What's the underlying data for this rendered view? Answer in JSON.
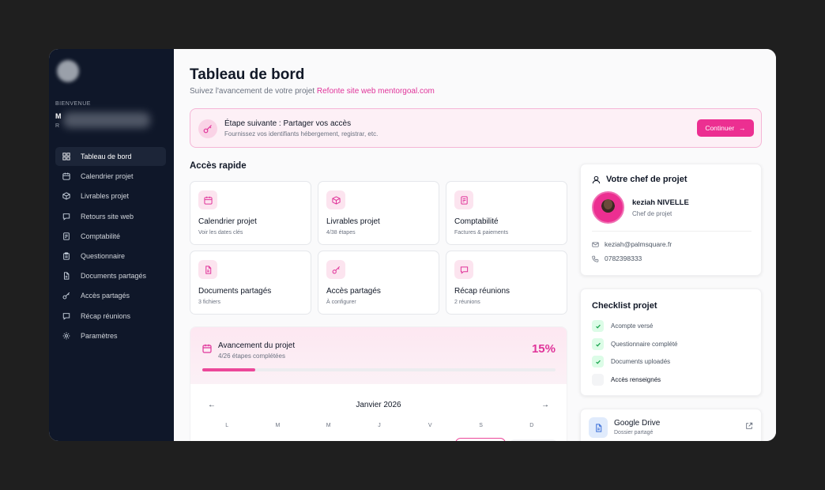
{
  "sidebar": {
    "welcome": "BIENVENUE",
    "user_initial": "M",
    "user_sub_initial": "R",
    "items": [
      {
        "label": "Tableau de bord",
        "icon": "dashboard-icon",
        "active": true
      },
      {
        "label": "Calendrier projet",
        "icon": "calendar-icon"
      },
      {
        "label": "Livrables projet",
        "icon": "package-icon"
      },
      {
        "label": "Retours site web",
        "icon": "message-icon"
      },
      {
        "label": "Comptabilité",
        "icon": "receipt-icon"
      },
      {
        "label": "Questionnaire",
        "icon": "clipboard-icon"
      },
      {
        "label": "Documents partagés",
        "icon": "document-icon"
      },
      {
        "label": "Accès partagés",
        "icon": "key-icon"
      },
      {
        "label": "Récap réunions",
        "icon": "chat-icon"
      },
      {
        "label": "Paramètres",
        "icon": "gear-icon"
      }
    ]
  },
  "header": {
    "title": "Tableau de bord",
    "subtitle_prefix": "Suivez l'avancement de votre projet",
    "project_link": "Refonte site web mentorgoal.com"
  },
  "banner": {
    "title": "Étape suivante : Partager vos accès",
    "description": "Fournissez vos identifiants hébergement, registrar, etc.",
    "button_label": "Continuer",
    "button_arrow": "→"
  },
  "quick_access": {
    "title": "Accès rapide",
    "cards": [
      {
        "title": "Calendrier projet",
        "sub": "Voir les dates clés",
        "icon": "calendar-icon"
      },
      {
        "title": "Livrables projet",
        "sub": "4/38 étapes",
        "icon": "package-icon"
      },
      {
        "title": "Comptabilité",
        "sub": "Factures & paiements",
        "icon": "receipt-icon"
      },
      {
        "title": "Documents partagés",
        "sub": "3 fichiers",
        "icon": "document-icon"
      },
      {
        "title": "Accès partagés",
        "sub": "À configurer",
        "icon": "key-icon"
      },
      {
        "title": "Récap réunions",
        "sub": "2 réunions",
        "icon": "chat-icon"
      }
    ]
  },
  "progress": {
    "title": "Avancement du projet",
    "sub": "4/26 étapes complétées",
    "percent_label": "15%",
    "percent_value": 15
  },
  "calendar": {
    "month": "Janvier 2026",
    "prev": "←",
    "next": "→",
    "weekdays": [
      "L",
      "M",
      "M",
      "J",
      "V",
      "S",
      "D"
    ]
  },
  "chef": {
    "title": "Votre chef de projet",
    "name": "keziah NIVELLE",
    "role": "Chef de projet",
    "email": "keziah@palmsquare.fr",
    "phone": "0782398333"
  },
  "checklist": {
    "title": "Checklist projet",
    "items": [
      {
        "label": "Acompte versé",
        "done": true
      },
      {
        "label": "Questionnaire complété",
        "done": true
      },
      {
        "label": "Documents uploadés",
        "done": true
      },
      {
        "label": "Accès renseignés",
        "done": false
      }
    ]
  },
  "drive": {
    "title": "Google Drive",
    "sub": "Dossier partagé"
  },
  "colors": {
    "accent": "#ec2f91",
    "sidebar_bg": "#0f1729",
    "success": "#16a34a"
  }
}
